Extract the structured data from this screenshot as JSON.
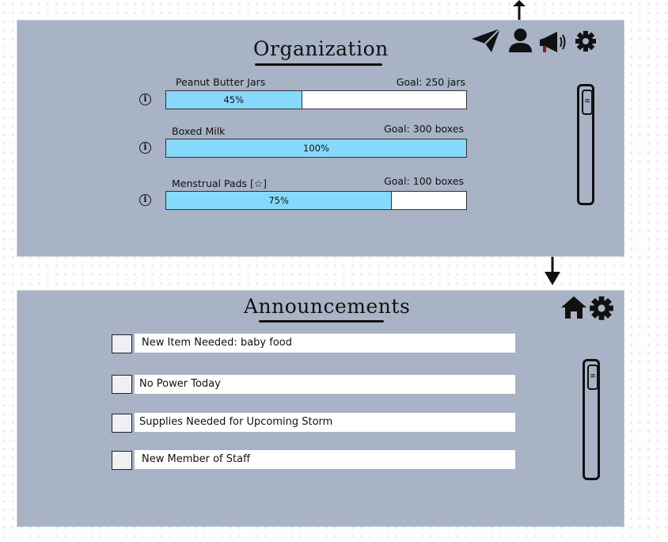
{
  "organization": {
    "title": "Organization",
    "items": [
      {
        "name": "Peanut Butter Jars",
        "goal": "Goal: 250 jars",
        "progress_text": "45%",
        "progress": 0.45
      },
      {
        "name": "Boxed Milk",
        "goal": "Goal: 300 boxes",
        "progress_text": "100%",
        "progress": 1.0
      },
      {
        "name": "Menstrual Pads [☆]",
        "goal": "Goal: 100 boxes",
        "progress_text": "75%",
        "progress": 0.75
      }
    ],
    "toolbar_icons": [
      "paper-plane-icon",
      "user-icon",
      "megaphone-icon",
      "gear-icon"
    ]
  },
  "announcements": {
    "title": "Announcements",
    "items": [
      {
        "text": "New Item Needed: baby food",
        "checked": false
      },
      {
        "text": "No Power Today",
        "checked": false
      },
      {
        "text": "Supplies Needed for Upcoming Storm",
        "checked": false
      },
      {
        "text": "New Member of Staff",
        "checked": false
      }
    ],
    "toolbar_icons": [
      "home-icon",
      "gear-icon"
    ]
  },
  "colors": {
    "panel_bg": "#a8b3c5",
    "progress_fill": "#86d9fb",
    "megaphone_accent": "#8b1d1d"
  }
}
